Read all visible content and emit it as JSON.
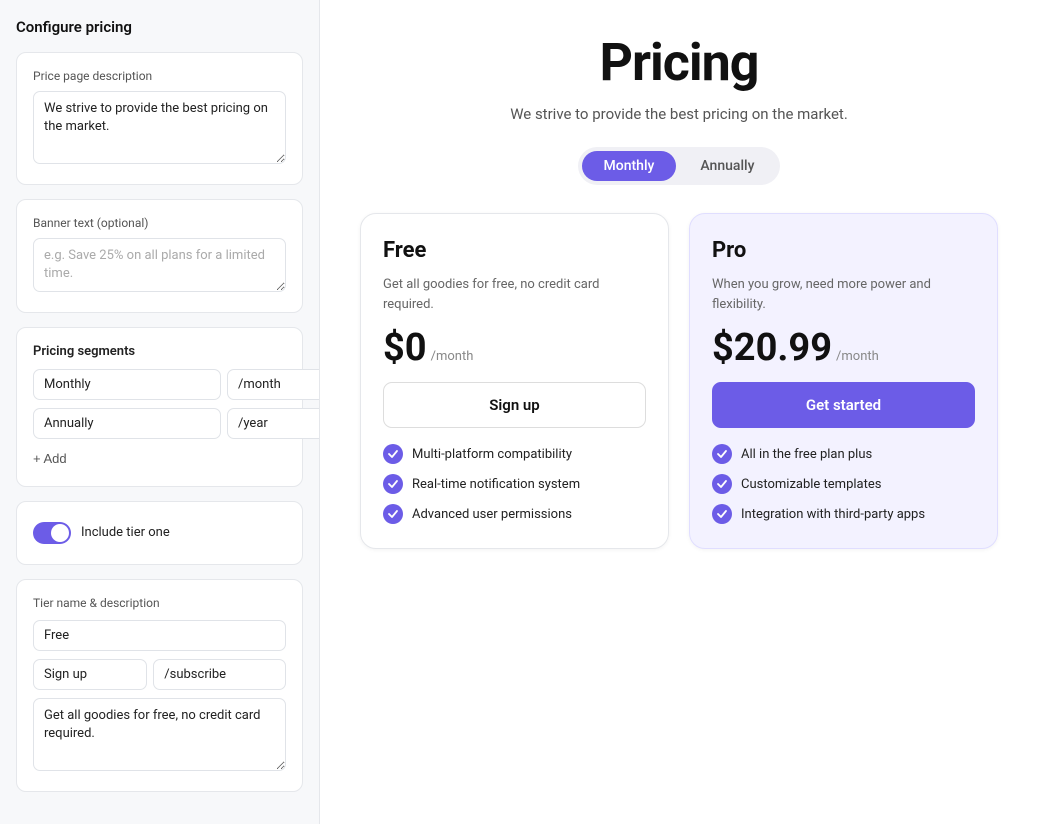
{
  "app": {
    "title": "Configure pricing"
  },
  "left_panel": {
    "price_description_label": "Price page description",
    "price_description_value": "We strive to provide the best pricing on the market.",
    "banner_text_label": "Banner text (optional)",
    "banner_text_placeholder": "e.g. Save 25% on all plans for a limited time.",
    "pricing_segments_label": "Pricing segments",
    "segments": [
      {
        "name": "Monthly",
        "suffix": "/month"
      },
      {
        "name": "Annually",
        "suffix": "/year"
      }
    ],
    "add_label": "+ Add",
    "include_tier_label": "Include tier one",
    "tier_section_label": "Tier name & description",
    "tier_name_value": "Free",
    "tier_cta_value": "Sign up",
    "tier_cta_suffix": "/subscribe",
    "tier_desc_value": "Get all goodies for free, no credit card required."
  },
  "right_panel": {
    "heading": "Pricing",
    "subtitle": "We strive to provide the best pricing on the market.",
    "tabs": [
      {
        "label": "Monthly",
        "active": true
      },
      {
        "label": "Annually",
        "active": false
      }
    ],
    "plans": [
      {
        "name": "Free",
        "desc": "Get all goodies for free, no credit card required.",
        "price_main": "$0",
        "price_period": "/month",
        "cta_label": "Sign up",
        "cta_type": "secondary",
        "features": [
          "Multi-platform compatibility",
          "Real-time notification system",
          "Advanced user permissions"
        ],
        "variant": "free"
      },
      {
        "name": "Pro",
        "desc": "When you grow, need more power and flexibility.",
        "price_main": "$20.99",
        "price_period": "/month",
        "cta_label": "Get started",
        "cta_type": "primary",
        "features": [
          "All in the free plan plus",
          "Customizable templates",
          "Integration with third-party apps"
        ],
        "variant": "pro"
      }
    ]
  },
  "icons": {
    "delete": "🗑",
    "check": "✓",
    "plus": "+"
  },
  "colors": {
    "accent": "#6c5ce7",
    "delete_red": "#e05555"
  }
}
